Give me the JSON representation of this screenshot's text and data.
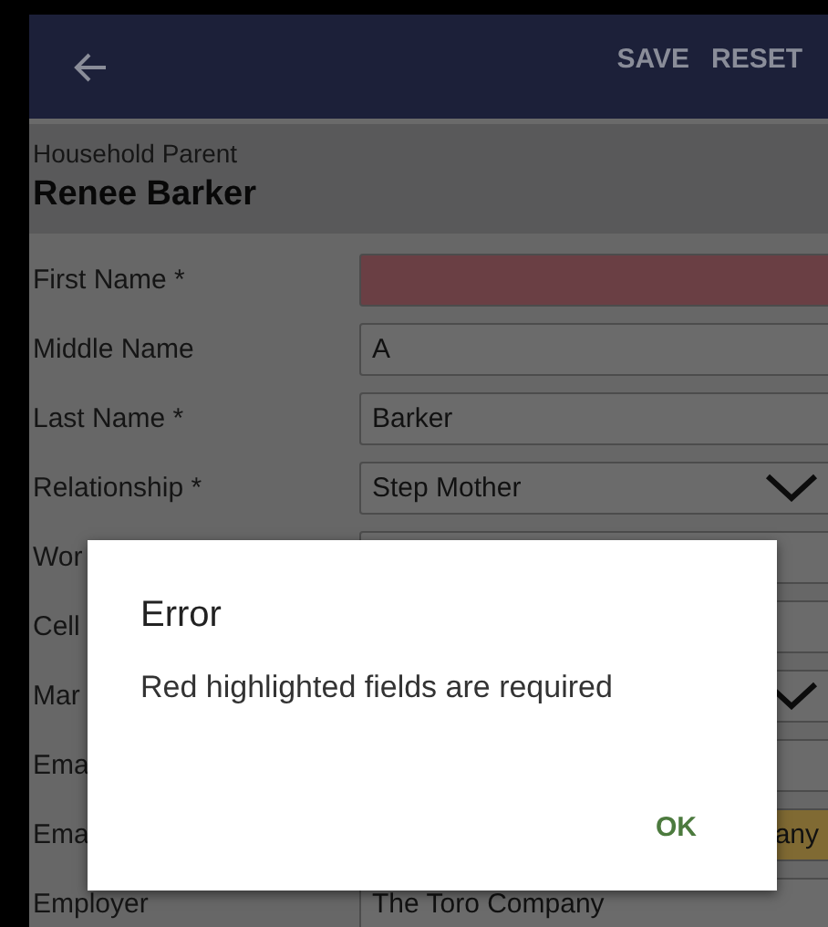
{
  "app_bar": {
    "actions": [
      "SAVE",
      "RESET"
    ]
  },
  "header": {
    "subtitle": "Household Parent",
    "name": "Renee Barker"
  },
  "fields": [
    {
      "kind": "text",
      "label": "First Name *",
      "error": true,
      "autofilled": false
    },
    {
      "kind": "text",
      "label": "Middle Name",
      "value": "A",
      "error": false,
      "autofilled": false
    },
    {
      "kind": "text",
      "label": "Last Name *",
      "value": "Barker",
      "error": false,
      "autofilled": false
    },
    {
      "kind": "dropdown",
      "label": "Relationship *",
      "value": "Step Mother",
      "error": false,
      "autofilled": false
    },
    {
      "kind": "text",
      "label": "Wor",
      "error": false,
      "autofilled": false
    },
    {
      "kind": "text",
      "label": "Cell",
      "error": false,
      "autofilled": false
    },
    {
      "kind": "dropdown",
      "label": "Mar",
      "error": false,
      "autofilled": false
    },
    {
      "kind": "text",
      "label": "Ema",
      "error": false,
      "autofilled": false
    },
    {
      "kind": "text",
      "label": "Ema",
      "value": "any",
      "error": false,
      "autofilled": true
    },
    {
      "kind": "text",
      "label": "Employer",
      "value": "The Toro Company",
      "error": false,
      "autofilled": false
    }
  ],
  "dialog": {
    "title": "Error",
    "message": "Red highlighted fields are required",
    "button": "OK"
  }
}
